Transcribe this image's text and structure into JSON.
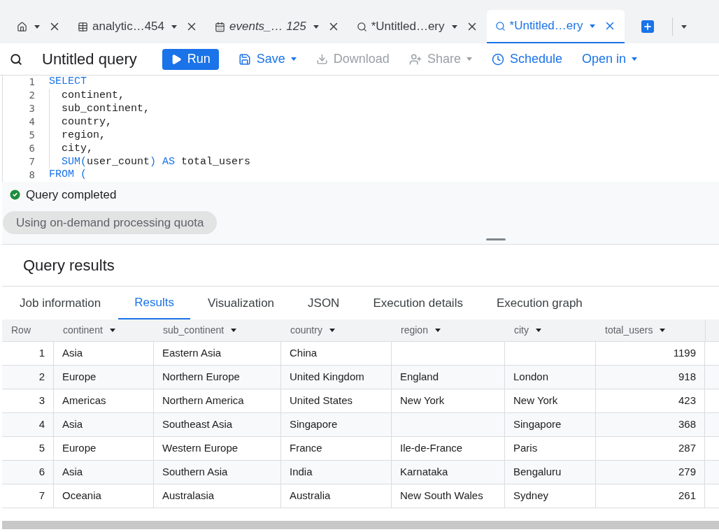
{
  "tabs": [
    {
      "kind": "home",
      "selected": false
    },
    {
      "kind": "table",
      "label": "analytic…454",
      "selected": false,
      "italic": false
    },
    {
      "kind": "events",
      "label": "events_… 125",
      "selected": false,
      "italic": true
    },
    {
      "kind": "query",
      "label": "*Untitled…ery",
      "selected": false,
      "italic": false
    },
    {
      "kind": "query",
      "label": "*Untitled…ery",
      "selected": true,
      "italic": false
    }
  ],
  "toolbar": {
    "title": "Untitled query",
    "actions": [
      {
        "kind": "run",
        "label": "Run",
        "disabled": false,
        "menu": false
      },
      {
        "kind": "save",
        "label": "Save",
        "disabled": false,
        "menu": true
      },
      {
        "kind": "download",
        "label": "Download",
        "disabled": true,
        "menu": false
      },
      {
        "kind": "share",
        "label": "Share",
        "disabled": true,
        "menu": true
      },
      {
        "kind": "schedule",
        "label": "Schedule",
        "disabled": false,
        "menu": false
      },
      {
        "kind": "open",
        "label": "Open in",
        "disabled": false,
        "menu": true
      }
    ]
  },
  "editor": {
    "lines": [
      {
        "number": "1",
        "indent": false,
        "tokens": [
          {
            "kind": "keyword",
            "text": "SELECT"
          }
        ]
      },
      {
        "number": "2",
        "indent": true,
        "tokens": [
          {
            "kind": "plain",
            "text": "continent,"
          }
        ]
      },
      {
        "number": "3",
        "indent": true,
        "tokens": [
          {
            "kind": "plain",
            "text": "sub_continent,"
          }
        ]
      },
      {
        "number": "4",
        "indent": true,
        "tokens": [
          {
            "kind": "plain",
            "text": "country,"
          }
        ]
      },
      {
        "number": "5",
        "indent": true,
        "tokens": [
          {
            "kind": "plain",
            "text": "region,"
          }
        ]
      },
      {
        "number": "6",
        "indent": true,
        "tokens": [
          {
            "kind": "plain",
            "text": "city,"
          }
        ]
      },
      {
        "number": "7",
        "indent": true,
        "tokens": [
          {
            "kind": "keyword",
            "text": "SUM("
          },
          {
            "kind": "plain",
            "text": "user_count"
          },
          {
            "kind": "keyword",
            "text": ") AS"
          },
          {
            "kind": "plain",
            "text": " total_users"
          }
        ]
      },
      {
        "number": "8",
        "indent": false,
        "tokens": [
          {
            "kind": "keyword",
            "text": "FROM ("
          }
        ]
      }
    ]
  },
  "status": {
    "message": "Query completed",
    "quota": "Using on-demand processing quota"
  },
  "results": {
    "title": "Query results",
    "tabs": [
      {
        "label": "Job information",
        "selected": false
      },
      {
        "label": "Results",
        "selected": true
      },
      {
        "label": "Visualization",
        "selected": false
      },
      {
        "label": "JSON",
        "selected": false
      },
      {
        "label": "Execution details",
        "selected": false
      },
      {
        "label": "Execution graph",
        "selected": false
      }
    ],
    "table": {
      "columns": [
        {
          "label": "Row",
          "sortable": false
        },
        {
          "label": "continent",
          "sortable": true
        },
        {
          "label": "sub_continent",
          "sortable": true
        },
        {
          "label": "country",
          "sortable": true
        },
        {
          "label": "region",
          "sortable": true
        },
        {
          "label": "city",
          "sortable": true
        },
        {
          "label": "total_users",
          "sortable": true
        }
      ],
      "rows": [
        [
          "1",
          "Asia",
          "Eastern Asia",
          "China",
          "",
          "",
          "1199"
        ],
        [
          "2",
          "Europe",
          "Northern Europe",
          "United Kingdom",
          "England",
          "London",
          "918"
        ],
        [
          "3",
          "Americas",
          "Northern America",
          "United States",
          "New York",
          "New York",
          "423"
        ],
        [
          "4",
          "Asia",
          "Southeast Asia",
          "Singapore",
          "",
          "Singapore",
          "368"
        ],
        [
          "5",
          "Europe",
          "Western Europe",
          "France",
          "Ile-de-France",
          "Paris",
          "287"
        ],
        [
          "6",
          "Asia",
          "Southern Asia",
          "India",
          "Karnataka",
          "Bengaluru",
          "279"
        ],
        [
          "7",
          "Oceania",
          "Australasia",
          "Australia",
          "New South Wales",
          "Sydney",
          "261"
        ]
      ]
    }
  }
}
